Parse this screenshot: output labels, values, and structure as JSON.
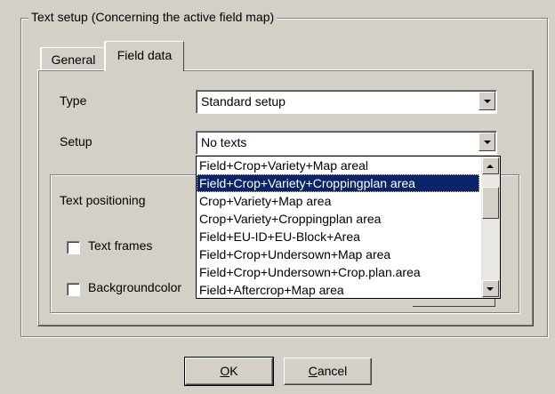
{
  "groupbox": {
    "title": "Text setup  (Concerning the active field map)"
  },
  "tabs": [
    {
      "label": "General",
      "active": false
    },
    {
      "label": "Field data",
      "active": true
    }
  ],
  "fields": {
    "type": {
      "label": "Type",
      "value": "Standard setup"
    },
    "setup": {
      "label": "Setup",
      "value": "No texts"
    }
  },
  "text_positioning": {
    "label": "Text positioning",
    "text_frames": {
      "label": "Text frames",
      "checked": false
    },
    "background_color": {
      "label": "Backgroundcolor",
      "checked": false
    }
  },
  "dropdown": {
    "selected_index": 1,
    "items": [
      "Field+Crop+Variety+Map areal",
      "Field+Crop+Variety+Croppingplan area",
      "Crop+Variety+Map area",
      "Crop+Variety+Croppingplan area",
      "Field+EU-ID+EU-Block+Area",
      "Field+Crop+Undersown+Map area",
      "Field+Crop+Undersown+Crop.plan.area",
      "Field+Aftercrop+Map area"
    ]
  },
  "buttons": {
    "ok": {
      "mnemonic": "O",
      "rest": "K"
    },
    "cancel": {
      "mnemonic": "C",
      "rest": "ancel"
    }
  },
  "colors": {
    "face": "#d4d0c8",
    "selection": "#0a246a"
  }
}
